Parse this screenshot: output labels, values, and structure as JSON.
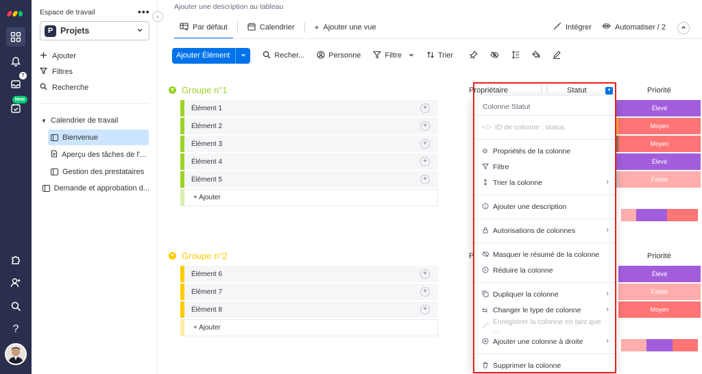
{
  "sidebar": {
    "workspace_label": "Espace de travail",
    "workspace_icon_letter": "P",
    "workspace_name": "Projets",
    "actions": [
      {
        "label": "Ajouter",
        "icon": "plus-icon"
      },
      {
        "label": "Filtres",
        "icon": "filter-icon"
      },
      {
        "label": "Recherche",
        "icon": "search-icon"
      }
    ],
    "folder": "Calendrier de travail",
    "folder_items": [
      "Bienvenue",
      "Aperçu des tâches de l'...",
      "Gestion des prestataires"
    ],
    "board_outside": "Demande et approbation d..."
  },
  "rail": {
    "inbox_badge": "7",
    "new_badge": "New",
    "help": "?"
  },
  "header": {
    "description": "Ajouter une description au tableau",
    "tabs": [
      "Par défaut",
      "Calendrier"
    ],
    "add_view": "Ajouter une vue",
    "integrate": "Intégrer",
    "automate": "Automatiser / 2"
  },
  "toolbar": {
    "add_item": "Ajouter Élément",
    "search": "Recher...",
    "person": "Personne",
    "filter": "Filtre",
    "sort": "Trier"
  },
  "columns": {
    "owner": "Propriétaire",
    "owner_short": "P",
    "status": "Statut",
    "priority": "Priorité"
  },
  "groups": [
    {
      "title": "Groupe n°1",
      "color": "#9cd326",
      "items": [
        {
          "name": "Élément 1",
          "priority": "Élevé"
        },
        {
          "name": "Élément 2",
          "priority": "Moyen"
        },
        {
          "name": "Élément 3",
          "priority": "Moyen"
        },
        {
          "name": "Élément 4",
          "priority": "Élevé"
        },
        {
          "name": "Élément 5",
          "priority": "Faible"
        }
      ],
      "add_label": "+ Ajouter"
    },
    {
      "title": "Groupe n°2",
      "color": "#ffcb00",
      "items": [
        {
          "name": "Élément 6",
          "priority": "Élevé"
        },
        {
          "name": "Élément 7",
          "priority": "Faible"
        },
        {
          "name": "Élément 8",
          "priority": "Moyen"
        }
      ],
      "add_label": "+ Ajouter"
    }
  ],
  "priority_colors": {
    "Élevé": "#a25ddc",
    "Moyen": "#ff7575",
    "Faible": "#ffadad"
  },
  "menu": {
    "header": "Colonne Statut",
    "column_id": "ID de colonne : status",
    "items": {
      "properties": "Propriétés de la colonne",
      "filter": "Filtre",
      "sort": "Trier la colonne",
      "add_description": "Ajouter une description",
      "permissions": "Autorisations de colonnes",
      "hide_summary": "Masquer le résumé de la colonne",
      "collapse": "Réduire la colonne",
      "duplicate": "Dupliquer la colonne",
      "change_type": "Changer le type de colonne",
      "save_as": "Enregistrer la colonne en tant que ...",
      "add_right": "Ajouter une colonne à droite",
      "delete": "Supprimer la colonne"
    }
  }
}
